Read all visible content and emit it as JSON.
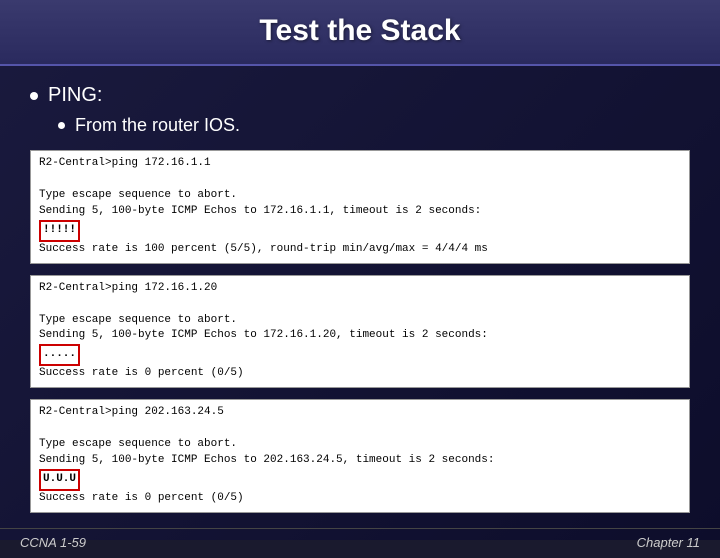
{
  "header": {
    "title": "Test the Stack"
  },
  "bullets": {
    "main": "PING:",
    "sub": "From the router IOS."
  },
  "terminals": [
    {
      "id": "t1",
      "lines": [
        "R2-Central>ping 172.16.1.1",
        "",
        "Type escape sequence to abort.",
        "Sending 5, 100-byte ICMP Echos to 172.16.1.1, timeout is 2 seconds:",
        "highlight:!!!!!",
        "Success rate is 100 percent (5/5), round-trip min/avg/max = 4/4/4 ms"
      ]
    },
    {
      "id": "t2",
      "lines": [
        "R2-Central>ping 172.16.1.20",
        "",
        "Type escape sequence to abort.",
        "Sending 5, 100-byte ICMP Echos to 172.16.1.20, timeout is 2 seconds:",
        "highlight:.....",
        "Success rate is 0 percent (0/5)"
      ]
    },
    {
      "id": "t3",
      "lines": [
        "R2-Central>ping 202.163.24.5",
        "",
        "Type escape sequence to abort.",
        "Sending 5, 100-byte ICMP Echos to 202.163.24.5, timeout is 2 seconds:",
        "highlight:U.U.U",
        "Success rate is 0 percent (0/5)"
      ]
    }
  ],
  "footer": {
    "left": "CCNA 1-59",
    "right": "Chapter 11"
  }
}
